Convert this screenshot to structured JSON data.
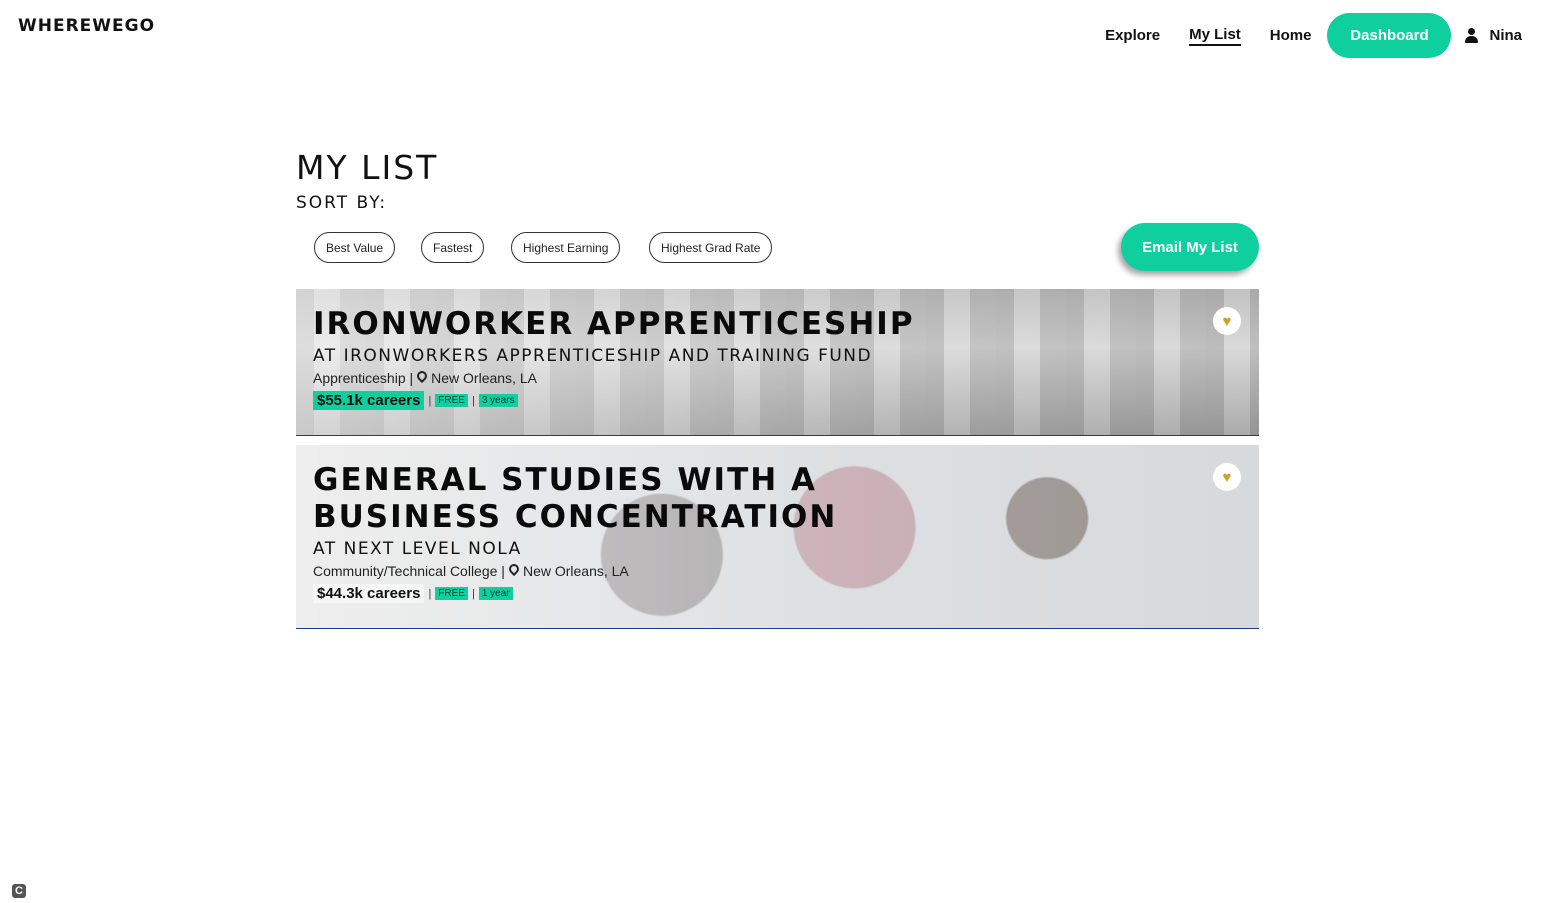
{
  "header": {
    "logo": "WHEREWEGO",
    "nav": {
      "explore": "Explore",
      "my_list": "My List",
      "home": "Home",
      "dashboard": "Dashboard",
      "user_name": "Nina"
    }
  },
  "main": {
    "title": "MY LIST",
    "sort_label": "SORT BY:",
    "sort_options": [
      "Best Value",
      "Fastest",
      "Highest Earning",
      "Highest Grad Rate"
    ],
    "email_button": "Email My List"
  },
  "programs": [
    {
      "title": "IRONWORKER APPRENTICESHIP",
      "provider": "AT IRONWORKERS APPRENTICESHIP AND TRAINING FUND",
      "type": "Apprenticeship |",
      "location": "New Orleans, LA",
      "careers": "$55.1k careers",
      "cost": "FREE",
      "duration": "3 years",
      "favorited": true
    },
    {
      "title": "GENERAL STUDIES WITH A BUSINESS CONCENTRATION",
      "provider": "AT NEXT LEVEL NOLA",
      "type": "Community/Technical College |",
      "location": "New Orleans, LA",
      "careers": "$44.3k careers",
      "cost": "FREE",
      "duration": "1 year",
      "favorited": true
    }
  ],
  "colors": {
    "accent": "#0fcf9f",
    "heart": "#c9a227",
    "card_border": "#1e3a8a"
  },
  "icons": {
    "user": "user-icon",
    "pin": "map-pin-icon",
    "heart": "heart-icon"
  },
  "footer": {
    "corner_badge": "C"
  }
}
